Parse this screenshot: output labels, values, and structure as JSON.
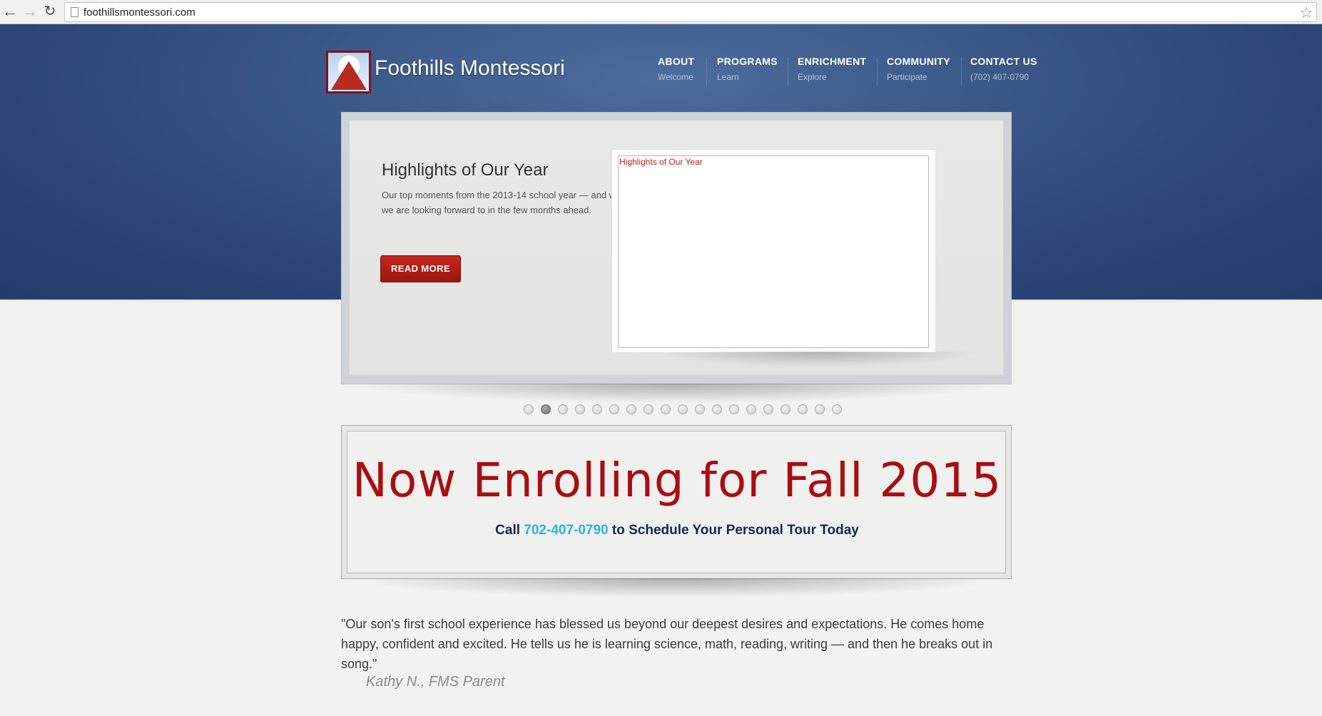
{
  "browser": {
    "url": "foothillsmontessori.com",
    "back_icon": "←",
    "forward_icon": "→",
    "reload_icon": "↻",
    "star_icon": "☆"
  },
  "site": {
    "title": "Foothills Montessori"
  },
  "nav": [
    {
      "label": "ABOUT",
      "sub": "Welcome"
    },
    {
      "label": "PROGRAMS",
      "sub": "Learn"
    },
    {
      "label": "ENRICHMENT",
      "sub": "Explore"
    },
    {
      "label": "COMMUNITY",
      "sub": "Participate"
    },
    {
      "label": "CONTACT US",
      "sub": "(702) 407-0790"
    }
  ],
  "slider": {
    "title": "Highlights of Our Year",
    "text": "Our top moments from the 2013-14 school year — and what we are looking forward to in the few months ahead.",
    "button": "READ MORE",
    "media_label": "Highlights of Our Year",
    "dot_count": 19,
    "active_dot": 2
  },
  "enroll": {
    "headline": "Now Enrolling for Fall 2015",
    "sub_prefix": "Call",
    "phone": "702-407-0790",
    "sub_suffix": "to Schedule Your Personal Tour Today"
  },
  "testimonial": {
    "quote": "\"Our son's first school experience has blessed us beyond our deepest desires and expectations. He comes home happy, confident and excited. He tells us he is learning science, math, reading, writing — and then he breaks out in song.\"",
    "author": "Kathy N., FMS Parent"
  },
  "colors": {
    "hero": "#2b4677",
    "accent_red": "#a80e12",
    "phone_blue": "#2ab4e4",
    "navy": "#13264f"
  }
}
